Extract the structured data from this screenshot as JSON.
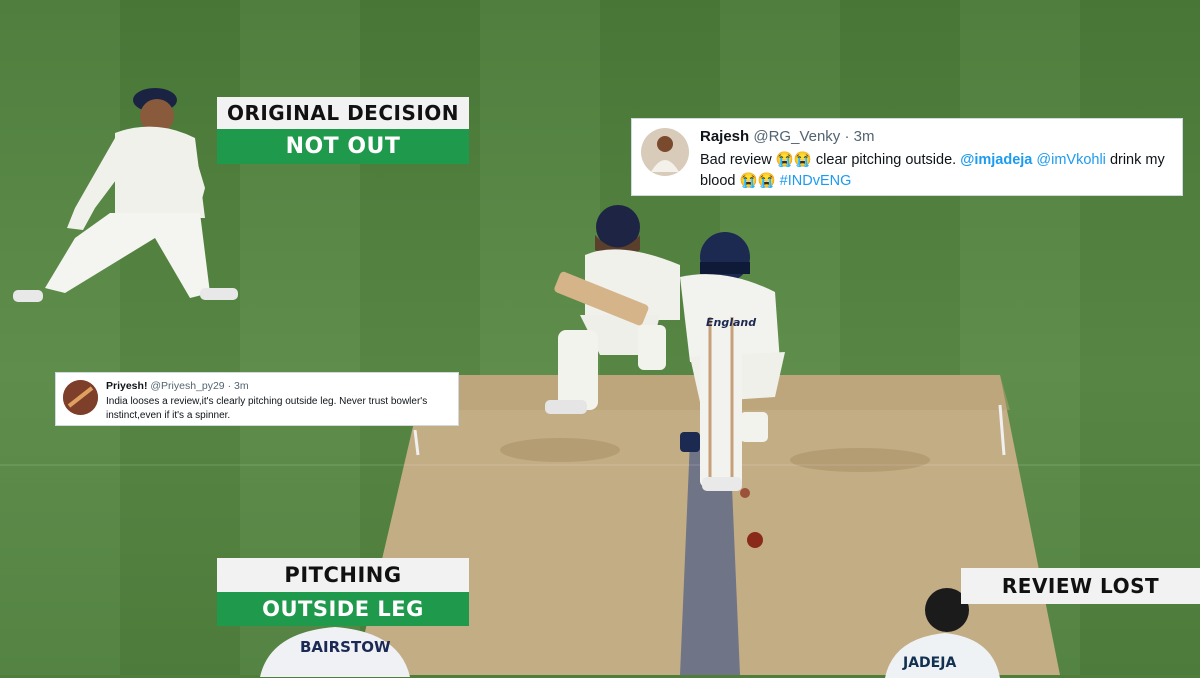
{
  "overlays": {
    "original_decision": {
      "title": "ORIGINAL DECISION",
      "value": "NOT OUT"
    },
    "pitching": {
      "title": "PITCHING",
      "value": "OUTSIDE LEG"
    },
    "review": {
      "text": "REVIEW LOST"
    }
  },
  "tweets": [
    {
      "name": "Rajesh",
      "handle": "@RG_Venky",
      "time": "3m",
      "text_1": "Bad review",
      "emoji_1": "😭😭",
      "text_2": "clear pitching outside.",
      "mention_1": "@imjadeja",
      "mention_2": "@imVkohli",
      "text_3": "drink my",
      "text_4": "blood",
      "emoji_2": "😭😭",
      "hashtag": "#INDvENG"
    },
    {
      "name": "Priyesh!",
      "handle": "@Priyesh_py29",
      "time": "3m",
      "line_1": "India looses a review,it's clearly pitching outside leg. Never trust bowler's",
      "line_2": "instinct,even if it's a spinner."
    }
  ],
  "jerseys": {
    "fielder_back": "BAIRSTOW",
    "bowler_back": "JADEJA",
    "batsman_chest": "England"
  },
  "colors": {
    "overlay_green": "#1f9a4c",
    "overlay_white": "#f2f2f2",
    "grass": "#4f7d3c",
    "pitch": "#c4ae86"
  }
}
